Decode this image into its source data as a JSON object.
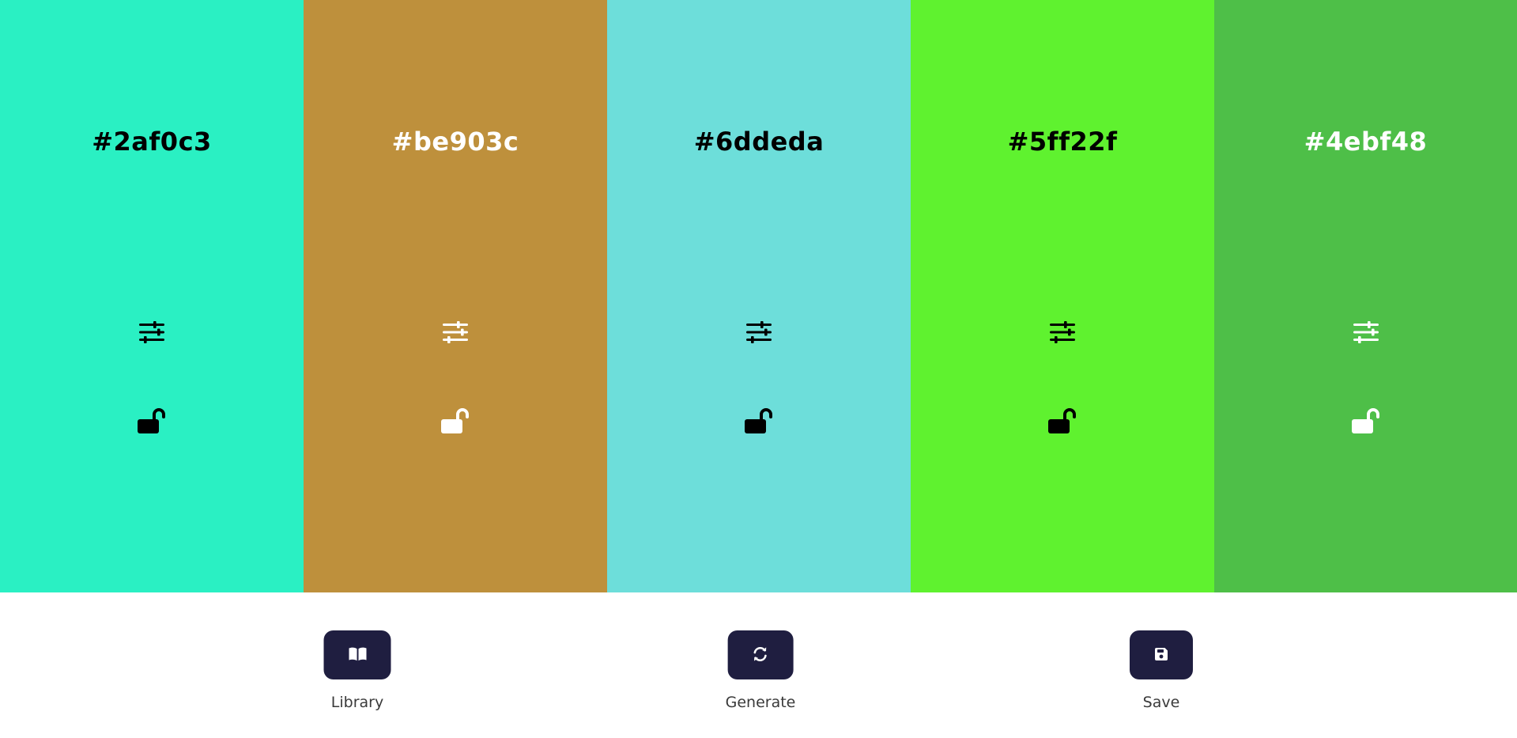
{
  "palette": {
    "swatches": [
      {
        "hex": "#2af0c3",
        "text_color": "#000000",
        "adjust_icon": "sliders-icon",
        "lock_icon": "unlock-icon"
      },
      {
        "hex": "#be903c",
        "text_color": "#ffffff",
        "adjust_icon": "sliders-icon",
        "lock_icon": "unlock-icon"
      },
      {
        "hex": "#6ddeda",
        "text_color": "#000000",
        "adjust_icon": "sliders-icon",
        "lock_icon": "unlock-icon"
      },
      {
        "hex": "#5ff22f",
        "text_color": "#000000",
        "adjust_icon": "sliders-icon",
        "lock_icon": "unlock-icon"
      },
      {
        "hex": "#4ebf48",
        "text_color": "#ffffff",
        "adjust_icon": "sliders-icon",
        "lock_icon": "unlock-icon"
      }
    ]
  },
  "controls": {
    "accent": "#1f1e40",
    "library": {
      "label": "Library",
      "icon": "book-open-icon"
    },
    "generate": {
      "label": "Generate",
      "icon": "refresh-icon"
    },
    "save": {
      "label": "Save",
      "icon": "floppy-disk-icon"
    }
  }
}
